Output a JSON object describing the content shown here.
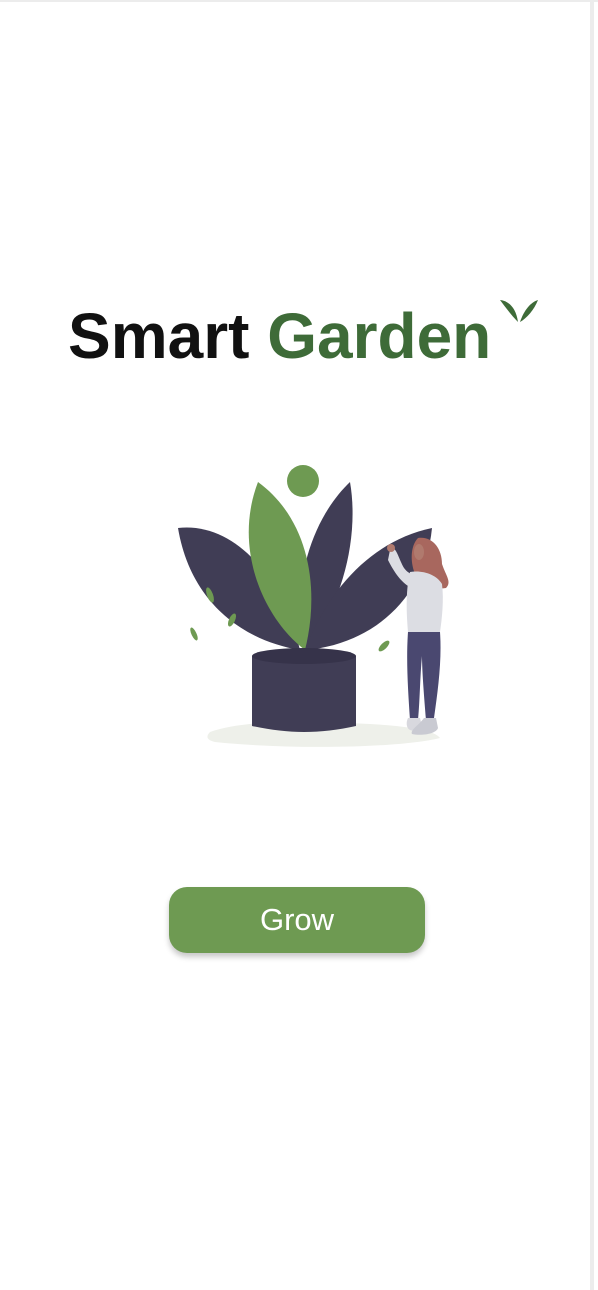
{
  "app": {
    "title_word_1": "Smart",
    "title_word_2": "Garden",
    "logo_icon": "sprout-icon",
    "illustration": "woman-with-giant-plant-illustration"
  },
  "actions": {
    "grow_label": "Grow"
  },
  "colors": {
    "brand_green": "#3e6b38",
    "button_green": "#6e9a52",
    "leaf_dark": "#403d55",
    "text_dark": "#111111",
    "background": "#ffffff"
  }
}
